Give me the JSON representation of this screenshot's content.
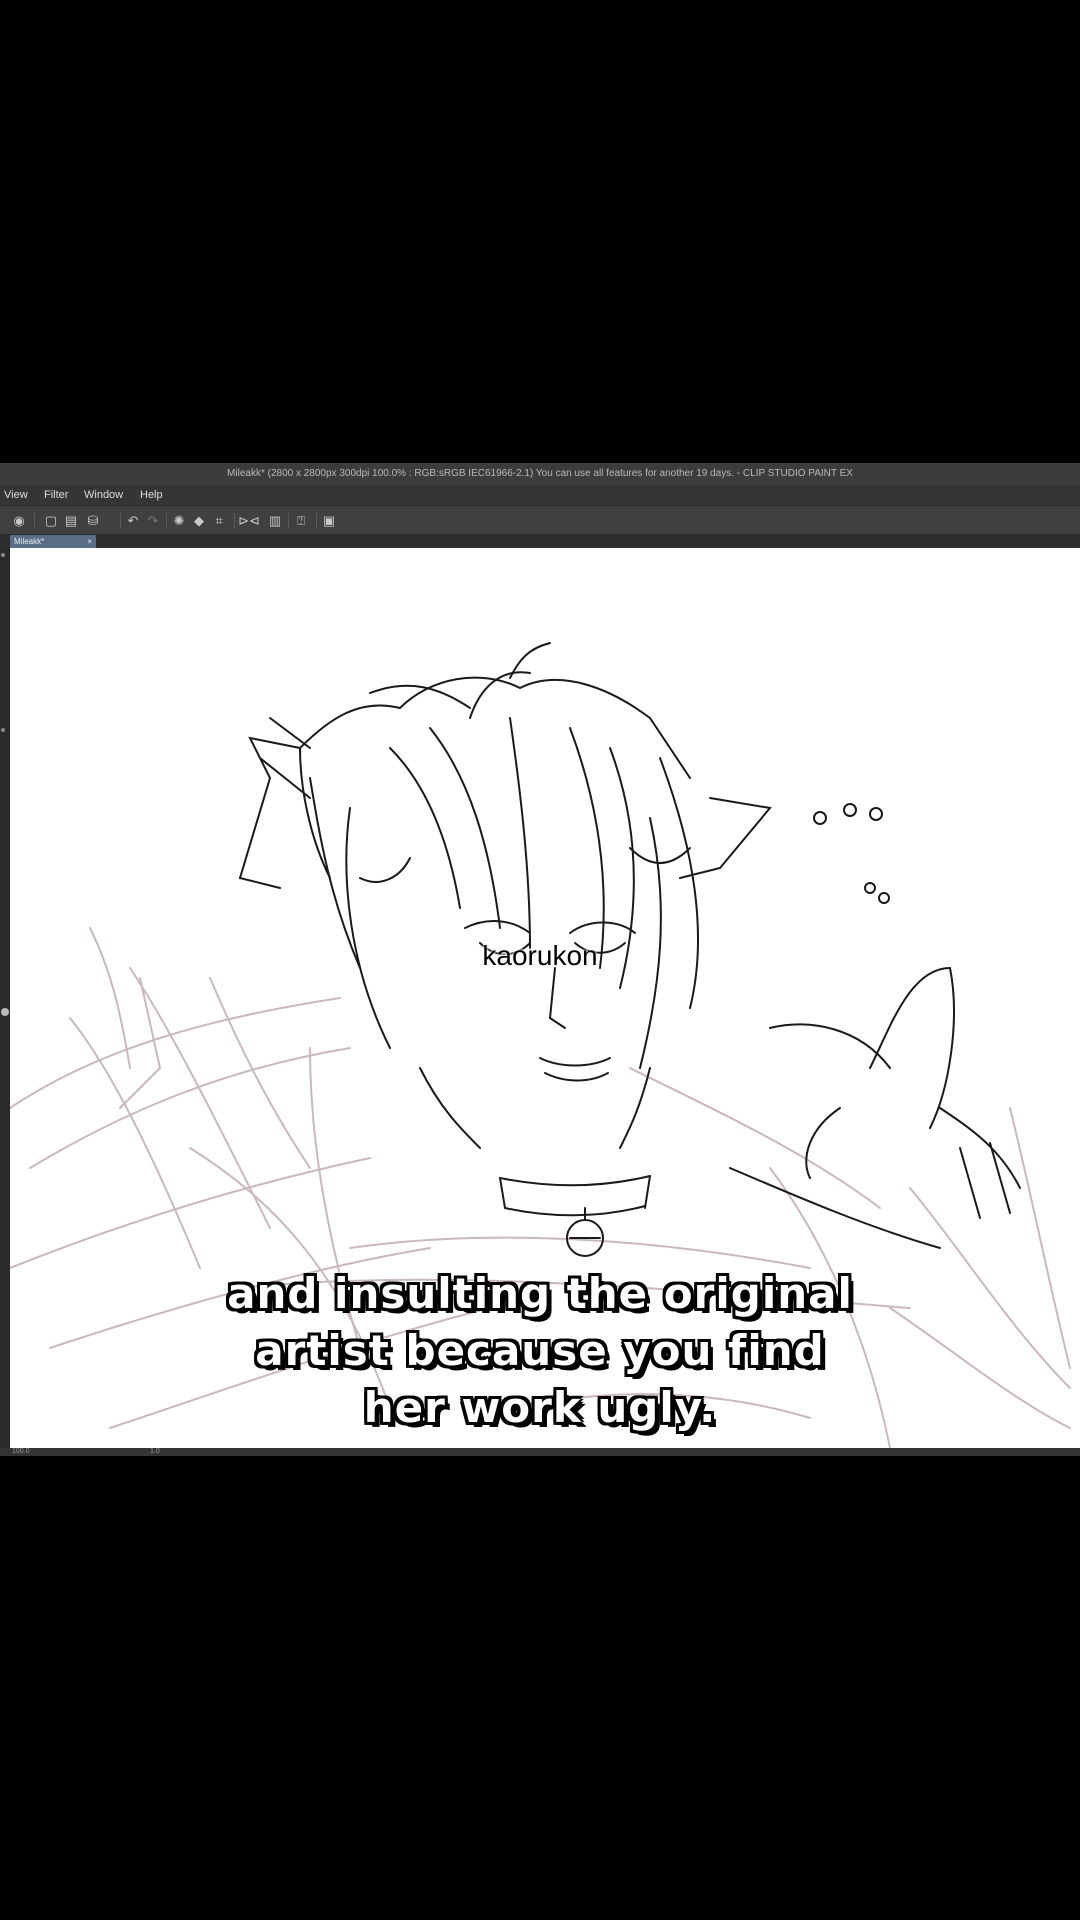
{
  "window": {
    "title": "Mileakk* (2800 x 2800px 300dpi 100.0% : RGB:sRGB IEC61966-2.1)  You can use all features for another 19 days. - CLIP STUDIO PAINT EX"
  },
  "menu": {
    "items": [
      "View",
      "Filter",
      "Window",
      "Help"
    ]
  },
  "toolbar": {
    "icons": [
      "layer-view-icon",
      "new-file-icon",
      "open-file-icon",
      "save-icon",
      "undo-icon",
      "redo-icon",
      "settings-icon",
      "fill-icon",
      "transform-icon",
      "flip-icon",
      "clip-icon",
      "help-icon",
      "panel-icon"
    ]
  },
  "document_tab": {
    "label": "Mileakk*",
    "close": "×"
  },
  "statusbar": {
    "zoom": "100.0",
    "brush_size": "1.0"
  },
  "overlay": {
    "watermark": "kaorukon",
    "caption": [
      "and insulting the original",
      "artist because you find",
      "her work ugly."
    ]
  },
  "colors": {
    "app_bg": "#3a3a3a",
    "tab_active": "#5a6e86",
    "sketch_black": "#1a1a1a",
    "sketch_rough": "#c9b8bc"
  }
}
